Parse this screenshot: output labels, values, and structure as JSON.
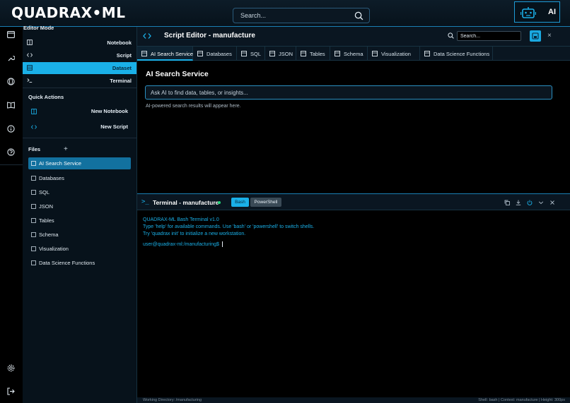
{
  "app": {
    "logo": "QUADRAX•ML",
    "search_placeholder": "Search...",
    "ai_label": "AI"
  },
  "rail": {
    "icons": [
      "window-icon",
      "tools-icon",
      "globe-icon",
      "book-icon",
      "info-icon",
      "help-icon",
      "settings-icon",
      "logout-icon"
    ]
  },
  "left_panel": {
    "editor_mode_title": "Editor Mode",
    "modes": [
      {
        "label": "Notebook",
        "icon": "notebook-icon"
      },
      {
        "label": "Script",
        "icon": "code-icon"
      },
      {
        "label": "Dataset",
        "icon": "database-icon",
        "active": true
      },
      {
        "label": "Terminal",
        "icon": "terminal-icon"
      }
    ],
    "quick_actions_title": "Quick Actions",
    "quick_actions": [
      {
        "label": "New Notebook",
        "icon": "notebook-icon"
      },
      {
        "label": "New Script",
        "icon": "code-icon"
      }
    ],
    "files_title": "Files",
    "files_plus": "+",
    "files": [
      {
        "label": "AI Search Service",
        "active": true
      },
      {
        "label": "Databases"
      },
      {
        "label": "SQL"
      },
      {
        "label": "JSON"
      },
      {
        "label": "Tables"
      },
      {
        "label": "Schema"
      },
      {
        "label": "Visualization"
      },
      {
        "label": "Data Science Functions"
      }
    ]
  },
  "editor": {
    "title": "Script Editor - manufacture",
    "search_placeholder": "Search...",
    "close": "×",
    "tabs": [
      {
        "label": "AI Search Service",
        "active": true
      },
      {
        "label": "Databases"
      },
      {
        "label": "SQL"
      },
      {
        "label": "JSON"
      },
      {
        "label": "Tables"
      },
      {
        "label": "Schema"
      },
      {
        "label": "Visualization"
      },
      {
        "label": "Data Science Functions"
      }
    ],
    "ai_search": {
      "title": "AI Search Service",
      "placeholder": "Ask AI to find data, tables, or insights...",
      "hint": "AI-powered search results will appear here."
    }
  },
  "terminal": {
    "prompt_icon": ">_",
    "title": "Terminal - manufacture",
    "bash_label": "Bash",
    "powershell_label": "PowerShell",
    "lines": [
      "QUADRAX-ML Bash Terminal v1.0",
      "Type 'help' for available commands. Use 'bash' or 'powershell' to switch shells.",
      "Try 'quadrax init' to initialize a new workstation."
    ],
    "prompt": "user@quadrax-ml:/manufacturing$"
  },
  "status": {
    "left": "Working Directory: /manufacturing",
    "right": "Shell: bash | Context: manufacture | Height: 300px"
  },
  "colors": {
    "accent": "#1ab0e8",
    "background": "#000000",
    "panel": "#07121b",
    "status_dot": "#22d67a"
  }
}
